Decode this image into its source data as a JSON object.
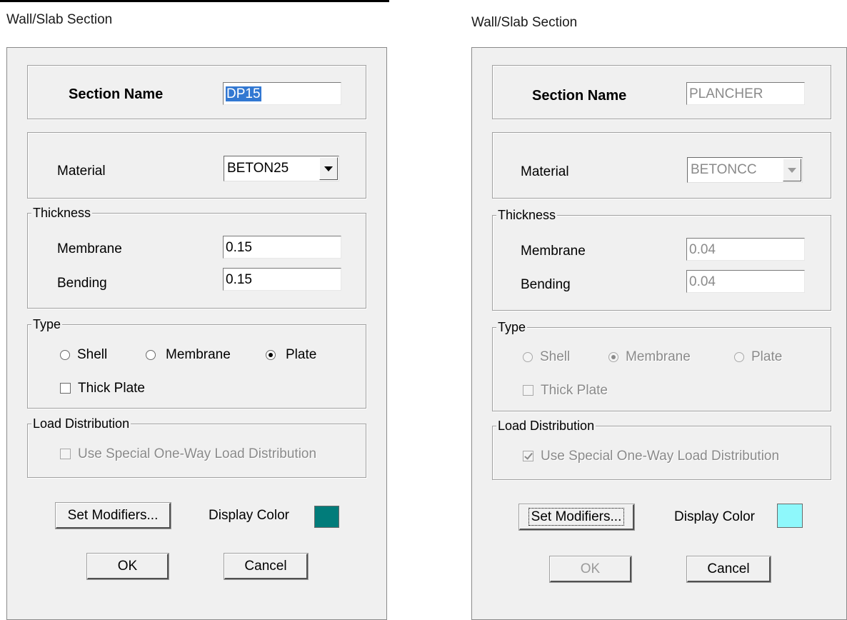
{
  "left": {
    "window_title": "Wall/Slab Section",
    "section_name_label": "Section Name",
    "section_name_value": "DP15",
    "material_label": "Material",
    "material_value": "BETON25",
    "thickness_legend": "Thickness",
    "membrane_label": "Membrane",
    "membrane_value": "0.15",
    "bending_label": "Bending",
    "bending_value": "0.15",
    "type_legend": "Type",
    "type_shell": "Shell",
    "type_membrane": "Membrane",
    "type_plate": "Plate",
    "type_selected": "Plate",
    "thick_plate_label": "Thick Plate",
    "thick_plate_checked": false,
    "load_legend": "Load Distribution",
    "one_way_label": "Use Special One-Way Load Distribution",
    "one_way_checked": false,
    "set_modifiers_label": "Set Modifiers...",
    "display_color_label": "Display Color",
    "display_color": "#017c7a",
    "ok_label": "OK",
    "cancel_label": "Cancel"
  },
  "right": {
    "window_title": "Wall/Slab Section",
    "section_name_label": "Section Name",
    "section_name_value": "PLANCHER",
    "material_label": "Material",
    "material_value": "BETONCC",
    "thickness_legend": "Thickness",
    "membrane_label": "Membrane",
    "membrane_value": "0.04",
    "bending_label": "Bending",
    "bending_value": "0.04",
    "type_legend": "Type",
    "type_shell": "Shell",
    "type_membrane": "Membrane",
    "type_plate": "Plate",
    "type_selected": "Membrane",
    "thick_plate_label": "Thick Plate",
    "thick_plate_checked": false,
    "load_legend": "Load Distribution",
    "one_way_label": "Use Special One-Way Load Distribution",
    "one_way_checked": true,
    "set_modifiers_label": "Set Modifiers...",
    "display_color_label": "Display Color",
    "display_color": "#8ef8fb",
    "ok_label": "OK",
    "cancel_label": "Cancel"
  }
}
